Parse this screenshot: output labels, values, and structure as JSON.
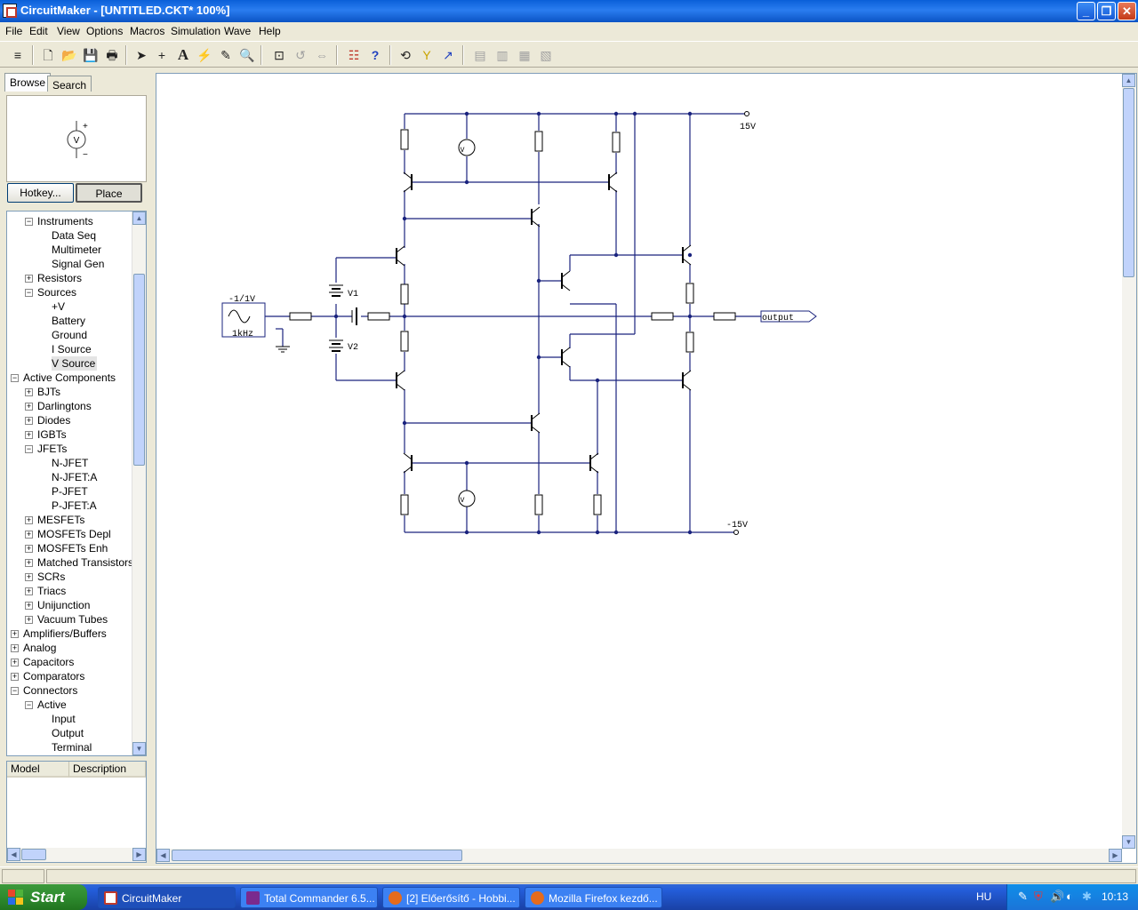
{
  "window": {
    "title": "CircuitMaker - [UNTITLED.CKT* 100%]"
  },
  "menu": [
    "File",
    "Edit",
    "View",
    "Options",
    "Macros",
    "Simulation",
    "Wave",
    "Help"
  ],
  "panel": {
    "tabs": [
      "Browse",
      "Search"
    ],
    "hotkey_label": "Hotkey...",
    "place_label": "Place",
    "preview_symbol": "V",
    "tree": [
      {
        "label": "Instruments",
        "level": 1,
        "toggle": "-"
      },
      {
        "label": "Data Seq",
        "level": 2
      },
      {
        "label": "Multimeter",
        "level": 2
      },
      {
        "label": "Signal Gen",
        "level": 2
      },
      {
        "label": "Resistors",
        "level": 1,
        "toggle": "+"
      },
      {
        "label": "Sources",
        "level": 1,
        "toggle": "-"
      },
      {
        "label": "+V",
        "level": 2
      },
      {
        "label": "Battery",
        "level": 2
      },
      {
        "label": "Ground",
        "level": 2
      },
      {
        "label": "I Source",
        "level": 2
      },
      {
        "label": "V Source",
        "level": 2,
        "selected": true
      },
      {
        "label": "Active Components",
        "level": 0,
        "toggle": "-"
      },
      {
        "label": "BJTs",
        "level": 1,
        "toggle": "+"
      },
      {
        "label": "Darlingtons",
        "level": 1,
        "toggle": "+"
      },
      {
        "label": "Diodes",
        "level": 1,
        "toggle": "+"
      },
      {
        "label": "IGBTs",
        "level": 1,
        "toggle": "+"
      },
      {
        "label": "JFETs",
        "level": 1,
        "toggle": "-"
      },
      {
        "label": "N-JFET",
        "level": 2
      },
      {
        "label": "N-JFET:A",
        "level": 2
      },
      {
        "label": "P-JFET",
        "level": 2
      },
      {
        "label": "P-JFET:A",
        "level": 2
      },
      {
        "label": "MESFETs",
        "level": 1,
        "toggle": "+"
      },
      {
        "label": "MOSFETs Depl",
        "level": 1,
        "toggle": "+"
      },
      {
        "label": "MOSFETs Enh",
        "level": 1,
        "toggle": "+"
      },
      {
        "label": "Matched Transistors",
        "level": 1,
        "toggle": "+"
      },
      {
        "label": "SCRs",
        "level": 1,
        "toggle": "+"
      },
      {
        "label": "Triacs",
        "level": 1,
        "toggle": "+"
      },
      {
        "label": "Unijunction",
        "level": 1,
        "toggle": "+"
      },
      {
        "label": "Vacuum Tubes",
        "level": 1,
        "toggle": "+"
      },
      {
        "label": "Amplifiers/Buffers",
        "level": 0,
        "toggle": "+"
      },
      {
        "label": "Analog",
        "level": 0,
        "toggle": "+"
      },
      {
        "label": "Capacitors",
        "level": 0,
        "toggle": "+"
      },
      {
        "label": "Comparators",
        "level": 0,
        "toggle": "+"
      },
      {
        "label": "Connectors",
        "level": 0,
        "toggle": "-"
      },
      {
        "label": "Active",
        "level": 1,
        "toggle": "-"
      },
      {
        "label": "Input",
        "level": 2
      },
      {
        "label": "Output",
        "level": 2
      },
      {
        "label": "Terminal",
        "level": 2
      }
    ],
    "table_headers": [
      "Model",
      "Description"
    ]
  },
  "schematic": {
    "source_amplitude": "-1/1V",
    "source_freq": "1kHz",
    "v1": "V1",
    "v2": "V2",
    "vplus": "15V",
    "vminus": "-15V",
    "output": "output",
    "meter_symbol": "V"
  },
  "taskbar": {
    "start": "Start",
    "tasks": [
      {
        "label": "CircuitMaker",
        "active": true
      },
      {
        "label": "Total Commander 6.5...",
        "active": false
      },
      {
        "label": "[2] Előerősítő - Hobbi...",
        "active": false
      },
      {
        "label": "Mozilla Firefox kezdő...",
        "active": false
      }
    ],
    "lang": "HU",
    "clock": "10:13"
  },
  "colors": {
    "wire": "#1a237e",
    "titlebar": "#0a5fd8",
    "start": "#2e8b2e"
  }
}
